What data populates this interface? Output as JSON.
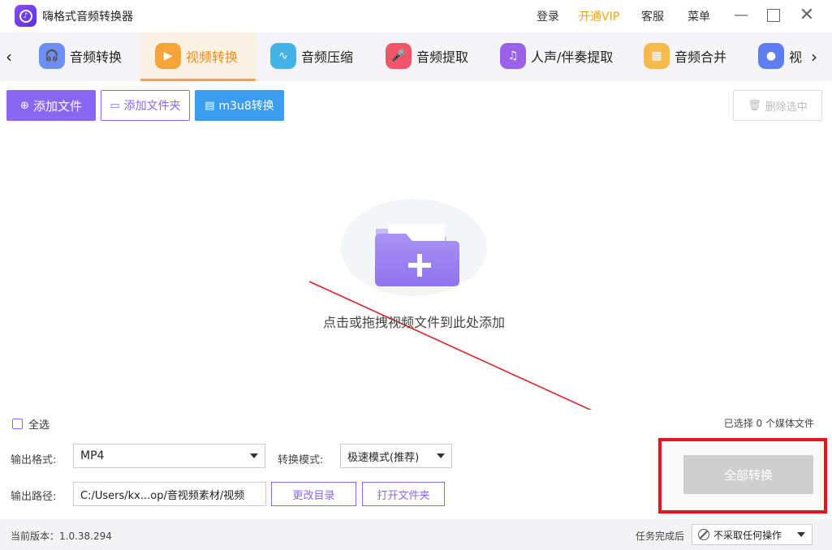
{
  "app": {
    "title": "嗨格式音频转换器"
  },
  "top_links": {
    "login": "登录",
    "vip": "开通VIP",
    "service": "客服",
    "menu": "菜单"
  },
  "colors": {
    "accent": "#8a67f3",
    "active_tab": "#f08c1a",
    "vip": "#f0a21a",
    "blue": "#3b9cf0",
    "highlight": "#e8141b"
  },
  "tabs": [
    {
      "label": "音频转换",
      "icon": "headphones-icon"
    },
    {
      "label": "视频转换",
      "icon": "video-icon",
      "active": true
    },
    {
      "label": "音频压缩",
      "icon": "waveform-icon"
    },
    {
      "label": "音频提取",
      "icon": "microphone-icon"
    },
    {
      "label": "人声/伴奏提取",
      "icon": "note-icon"
    },
    {
      "label": "音频合并",
      "icon": "merge-icon"
    },
    {
      "label": "视",
      "icon": "drop-icon"
    }
  ],
  "toolbar": {
    "add_file": "添加文件",
    "add_folder": "添加文件夹",
    "m3u8": "m3u8转换",
    "delete_selected": "删除选中"
  },
  "dropzone": {
    "hint": "点击或拖拽视频文件到此处添加"
  },
  "list": {
    "select_all": "全选",
    "selected_count": "已选择 0 个媒体文件"
  },
  "settings": {
    "format_label": "输出格式:",
    "format_value": "MP4",
    "mode_label": "转换模式:",
    "mode_value": "极速模式(推荐)",
    "path_label": "输出路径:",
    "path_value": "C:/Users/kx...op/音视频素材/视频",
    "change_dir": "更改目录",
    "open_folder": "打开文件夹"
  },
  "convert": {
    "label": "全部转换"
  },
  "status": {
    "version": "当前版本：1.0.38.294",
    "after_label": "任务完成后",
    "after_value": "不采取任何操作"
  }
}
